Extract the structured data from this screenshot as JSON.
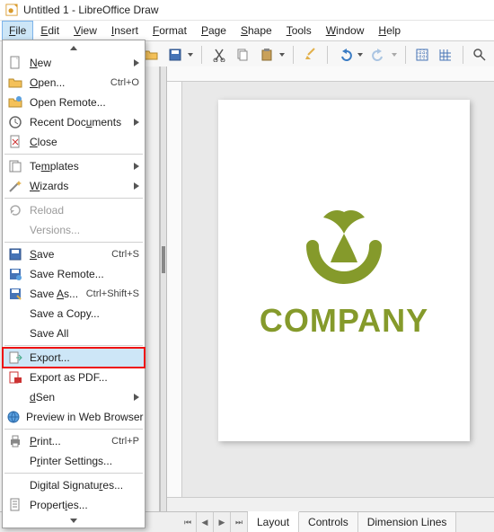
{
  "window": {
    "title": "Untitled 1 - LibreOffice Draw"
  },
  "menubar": {
    "items": [
      {
        "mnemonic": "F",
        "rest": "ile",
        "open": true
      },
      {
        "mnemonic": "E",
        "rest": "dit"
      },
      {
        "mnemonic": "V",
        "rest": "iew"
      },
      {
        "mnemonic": "I",
        "rest": "nsert"
      },
      {
        "mnemonic": "F",
        "rest": "ormat",
        "pre": ""
      },
      {
        "mnemonic": "P",
        "rest": "age"
      },
      {
        "mnemonic": "S",
        "rest": "hape"
      },
      {
        "mnemonic": "T",
        "rest": "ools"
      },
      {
        "mnemonic": "W",
        "rest": "indow"
      },
      {
        "mnemonic": "H",
        "rest": "elp"
      }
    ]
  },
  "file_menu": {
    "items": [
      {
        "icon": "new-doc-icon",
        "mn": "N",
        "rest": "ew",
        "shortcut": "",
        "submenu": true
      },
      {
        "icon": "open-folder-icon",
        "mn": "O",
        "rest": "pen...",
        "shortcut": "Ctrl+O"
      },
      {
        "icon": "open-remote-icon",
        "rest": "Open Remote...",
        "mn": "",
        "shortcut": ""
      },
      {
        "icon": "recent-icon",
        "rest": "Recent Doc",
        "mn": "u",
        "tail": "ments",
        "submenu": true
      },
      {
        "icon": "close-icon",
        "mn": "C",
        "rest": "lose"
      },
      {
        "sep": true
      },
      {
        "icon": "templates-icon",
        "rest": "Te",
        "mn": "m",
        "tail": "plates",
        "submenu": true
      },
      {
        "icon": "wizards-icon",
        "mn": "W",
        "rest": "izards",
        "submenu": true
      },
      {
        "sep": true
      },
      {
        "icon": "reload-icon",
        "rest": "Reload",
        "disabled": true
      },
      {
        "icon": "",
        "rest": "Versions...",
        "disabled": true
      },
      {
        "sep": true
      },
      {
        "icon": "save-icon",
        "mn": "S",
        "rest": "ave",
        "shortcut": "Ctrl+S"
      },
      {
        "icon": "save-remote-icon",
        "rest": "Save Remote..."
      },
      {
        "icon": "save-as-icon",
        "rest": "Save ",
        "mn": "A",
        "tail": "s...",
        "shortcut": "Ctrl+Shift+S"
      },
      {
        "icon": "",
        "rest": "Save a Copy..."
      },
      {
        "icon": "",
        "rest": "Save All"
      },
      {
        "sep": true
      },
      {
        "icon": "export-icon",
        "rest": "Export...",
        "highlight": true
      },
      {
        "icon": "export-pdf-icon",
        "rest": "Export as PDF..."
      },
      {
        "icon": "",
        "rest": "Sen",
        "mn": "d",
        "tail": "",
        "submenu": true
      },
      {
        "icon": "preview-icon",
        "rest": "Preview in Web Browser"
      },
      {
        "sep": true
      },
      {
        "icon": "print-icon",
        "mn": "P",
        "rest": "rint...",
        "shortcut": "Ctrl+P"
      },
      {
        "icon": "",
        "rest": "P",
        "mn": "r",
        "tail": "inter Settings..."
      },
      {
        "sep": true
      },
      {
        "icon": "",
        "rest": "Digital Signatu",
        "mn": "r",
        "tail": "es..."
      },
      {
        "icon": "properties-icon",
        "rest": "Propert",
        "mn": "i",
        "tail": "es..."
      }
    ]
  },
  "canvas": {
    "logo_text": "COMPANY",
    "accent": "#859a2b"
  },
  "tabs": {
    "items": [
      "Layout",
      "Controls",
      "Dimension Lines"
    ],
    "active": 0
  },
  "panel": {
    "thumb_label": ""
  }
}
